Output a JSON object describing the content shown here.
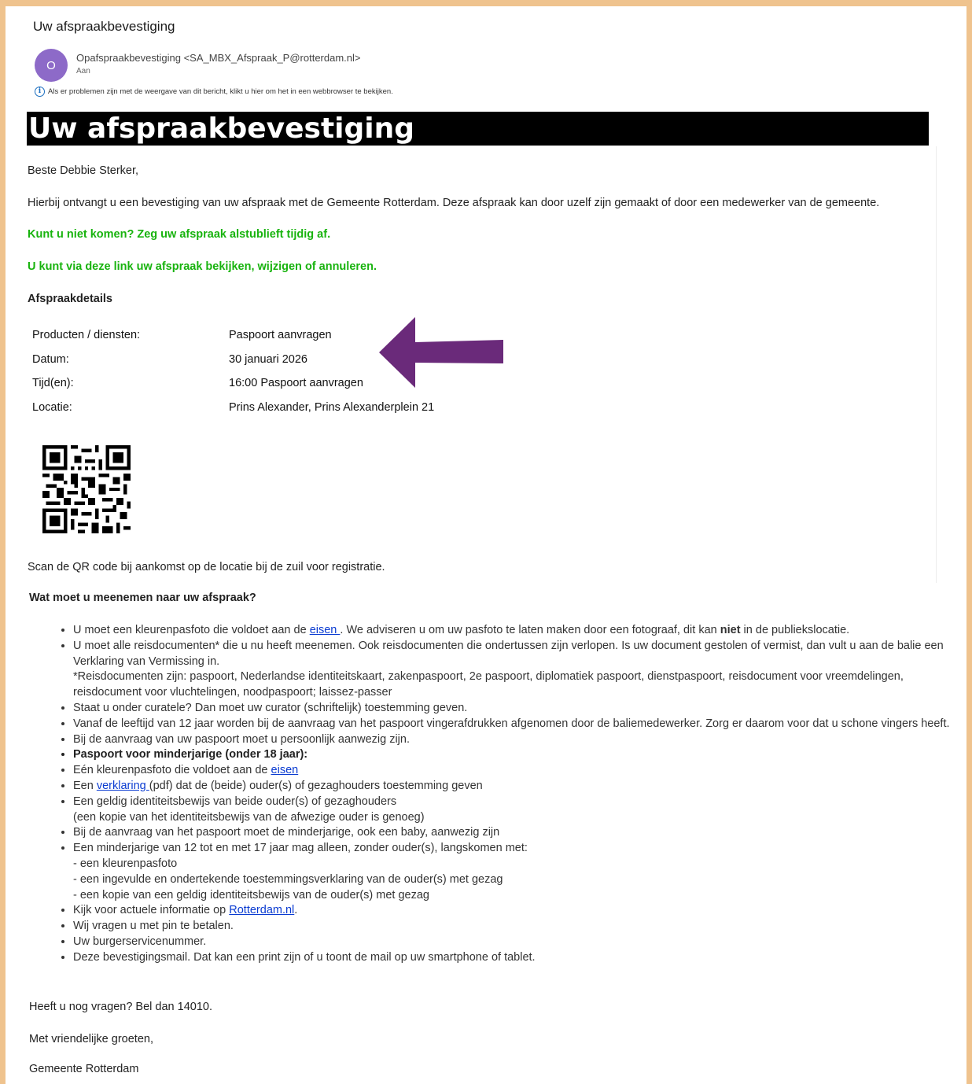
{
  "email": {
    "subject": "Uw afspraakbevestiging",
    "avatar_initial": "O",
    "sender": "Opafspraakbevestiging <SA_MBX_Afspraak_P@rotterdam.nl>",
    "to_label": "Aan",
    "info_notice": "Als er problemen zijn met de weergave van dit bericht, klikt u hier om het in een webbrowser te bekijken."
  },
  "body": {
    "banner_title": "Uw afspraakbevestiging",
    "greeting": "Beste Debbie Sterker,",
    "intro": "Hierbij ontvangt u een bevestiging van uw afspraak met de Gemeente Rotterdam. Deze afspraak kan door uzelf zijn gemaakt of door een medewerker van de gemeente.",
    "cancel_notice": "Kunt u niet komen? Zeg uw afspraak alstublieft tijdig af.",
    "link_notice": "U kunt via deze link uw afspraak bekijken, wijzigen of annuleren.",
    "details_heading": "Afspraakdetails",
    "details": [
      {
        "label": "Producten / diensten:",
        "value": "Paspoort aanvragen"
      },
      {
        "label": "Datum:",
        "value": "30 januari 2026"
      },
      {
        "label": "Tijd(en):",
        "value": "16:00 Paspoort aanvragen"
      },
      {
        "label": "Locatie:",
        "value": "Prins Alexander, Prins Alexanderplein 21"
      }
    ],
    "qr_instruction": "Scan de QR code bij aankomst op de locatie bij de zuil voor registratie.",
    "requirements_heading": "Wat moet u meenemen naar uw afspraak?",
    "requirements": {
      "r1_a": "U moet een kleurenpasfoto die voldoet aan de ",
      "r1_link": "eisen ",
      "r1_b": ". We adviseren u om uw pasfoto te laten maken door een fotograaf, dit kan ",
      "r1_bold": "niet",
      "r1_c": " in de publiekslocatie.",
      "r2_a": "U moet alle reisdocumenten* die u nu heeft meenemen. Ook reisdocumenten die ondertussen zijn verlopen. Is uw document gestolen of vermist, dan vult u aan de balie een Verklaring van Vermissing in.",
      "r2_b": "*Reisdocumenten zijn: paspoort, Nederlandse identiteitskaart, zakenpaspoort, 2e paspoort, diplomatiek paspoort, dienstpaspoort, reisdocument voor vreemdelingen, reisdocument voor vluchtelingen, noodpaspoort; laissez-passer",
      "r3": "Staat u onder curatele? Dan moet uw curator (schriftelijk) toestemming geven.",
      "r4": "Vanaf de leeftijd van 12 jaar worden bij de aanvraag van het paspoort vingerafdrukken afgenomen door de baliemedewerker. Zorg er daarom voor dat u schone vingers heeft.",
      "r5": "Bij de aanvraag van uw paspoort moet u persoonlijk aanwezig zijn.",
      "r6": "Paspoort voor minderjarige (onder 18 jaar):",
      "r7_a": "Eén kleurenpasfoto die voldoet aan de ",
      "r7_link": "eisen",
      "r8_a": "Een ",
      "r8_link": "verklaring ",
      "r8_b": "(pdf) dat de (beide) ouder(s) of gezaghouders toestemming geven",
      "r9_a": "Een geldig identiteitsbewijs van beide ouder(s) of gezaghouders",
      "r9_b": "(een kopie van het identiteitsbewijs van de afwezige ouder is genoeg)",
      "r10": "Bij de aanvraag van het paspoort moet de minderjarige, ook een baby, aanwezig zijn",
      "r11_a": "Een minderjarige van 12 tot en met 17 jaar mag alleen, zonder ouder(s), langskomen met:",
      "r11_b": "- een kleurenpasfoto",
      "r11_c": "- een ingevulde en ondertekende toestemmingsverklaring van de ouder(s) met gezag",
      "r11_d": "- een kopie van een geldig identiteitsbewijs van de ouder(s) met gezag",
      "r12_a": "Kijk voor actuele informatie op ",
      "r12_link": "Rotterdam.nl",
      "r12_b": ".",
      "r13": "Wij vragen u met pin te betalen.",
      "r14": "Uw burgerservicenummer.",
      "r15": "Deze bevestigingsmail. Dat kan een print zijn of u toont de mail op uw smartphone of tablet."
    },
    "questions": "Heeft u nog vragen? Bel dan 14010.",
    "closing": "Met vriendelijke groeten,",
    "signature": "Gemeente Rotterdam"
  },
  "colors": {
    "frame": "#efc38e",
    "avatar": "#8d6ac8",
    "green_text": "#18b30e",
    "arrow": "#6a2a7a",
    "link": "#0a3bd1"
  },
  "icons": {
    "info": "info-icon",
    "arrow": "left-arrow-annotation",
    "qr": "qr-code"
  }
}
